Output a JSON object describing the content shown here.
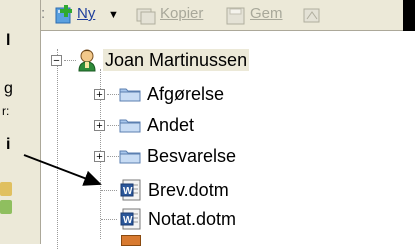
{
  "window_right_border_color": "#000000",
  "left_panel": {
    "partial_labels": [
      "l",
      "g",
      "r:",
      "i"
    ]
  },
  "toolbar": {
    "leading_text": ":",
    "new_label": "Ny",
    "copy_label": "Kopier",
    "save_label": "Gem"
  },
  "tree": {
    "root": {
      "label": "Joan Martinussen",
      "icon": "user-icon",
      "expander": "−"
    },
    "items": [
      {
        "label": "Afgørelse",
        "type": "folder",
        "expander": "+"
      },
      {
        "label": "Andet",
        "type": "folder",
        "expander": "+"
      },
      {
        "label": "Besvarelse",
        "type": "folder",
        "expander": "+"
      },
      {
        "label": "Brev.dotm",
        "type": "word-template"
      },
      {
        "label": "Notat.dotm",
        "type": "word-template"
      }
    ]
  },
  "colors": {
    "toolbar_bg": "#ece9d8",
    "link_blue": "#1f3f9c",
    "folder_blue": "#7fa9d9",
    "word_blue": "#2b579a"
  }
}
